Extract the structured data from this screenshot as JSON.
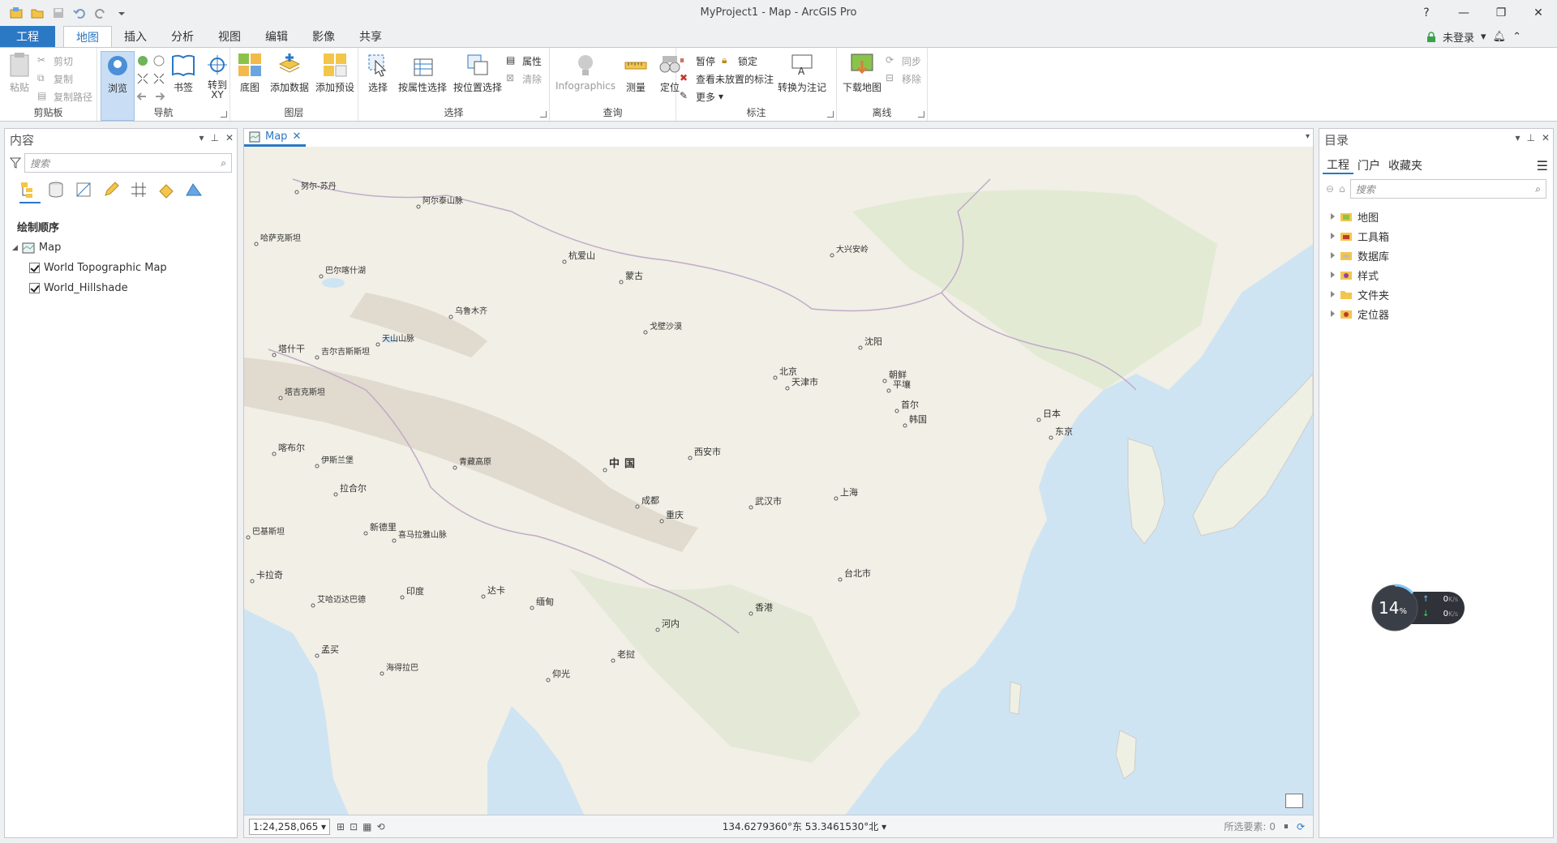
{
  "window": {
    "title": "MyProject1 - Map - ArcGIS Pro",
    "help": "?"
  },
  "ribbon_tabs": [
    "工程",
    "地图",
    "插入",
    "分析",
    "视图",
    "编辑",
    "影像",
    "共享"
  ],
  "account": {
    "label": "未登录"
  },
  "ribbon": {
    "clipboard": {
      "label": "剪贴板",
      "paste": "粘贴",
      "cut": "剪切",
      "copy": "复制",
      "copy_path": "复制路径"
    },
    "navigate": {
      "label": "导航",
      "explore": "浏览",
      "bookmarks": "书签",
      "goto_xy": "转到\nXY"
    },
    "layer": {
      "label": "图层",
      "basemap": "底图",
      "add_data": "添加数据",
      "add_preset": "添加预设"
    },
    "selection": {
      "label": "选择",
      "select": "选择",
      "by_attr": "按属性选择",
      "by_loc": "按位置选择",
      "attributes": "属性",
      "clear": "清除"
    },
    "inquiry": {
      "label": "查询",
      "infographics": "Infographics",
      "measure": "测量",
      "locate": "定位"
    },
    "labeling": {
      "label": "标注",
      "pause": "暂停",
      "lock": "锁定",
      "view_unplaced": "查看未放置的标注",
      "more": "更多",
      "convert": "转换为注记"
    },
    "offline": {
      "label": "离线",
      "download": "下载地图",
      "sync": "同步",
      "remove": "移除"
    }
  },
  "contents": {
    "title": "内容",
    "search_placeholder": "搜索",
    "section": "绘制顺序",
    "map_name": "Map",
    "layers": [
      "World Topographic Map",
      "World_Hillshade"
    ]
  },
  "map_tab": {
    "label": "Map"
  },
  "map_labels": [
    "努尔-苏丹",
    "阿尔泰山脉",
    "哈萨克斯坦",
    "巴尔喀什湖",
    "杭爱山",
    "蒙古",
    "乌鲁木齐",
    "戈壁沙漠",
    "天山山脉",
    "塔什干",
    "吉尔吉斯斯坦",
    "塔吉克斯坦",
    "喀布尔",
    "伊斯兰堡",
    "拉合尔",
    "青藏高原",
    "中国",
    "西安市",
    "北京",
    "天津市",
    "沈阳",
    "朝鲜",
    "平壤",
    "首尔",
    "韩国",
    "日本",
    "东京",
    "大兴安岭",
    "成都",
    "重庆",
    "武汉市",
    "上海",
    "巴基斯坦",
    "新德里",
    "喜马拉雅山脉",
    "卡拉奇",
    "印度",
    "艾哈迈达巴德",
    "达卡",
    "缅甸",
    "河内",
    "台北市",
    "香港",
    "老挝",
    "孟买",
    "海得拉巴",
    "仰光"
  ],
  "status": {
    "scale": "1:24,258,065",
    "coords": "134.6279360°东 53.3461530°北",
    "selected": "所选要素: 0"
  },
  "catalog": {
    "title": "目录",
    "tabs": [
      "工程",
      "门户",
      "收藏夹"
    ],
    "search_placeholder": "搜索",
    "items": [
      "地图",
      "工具箱",
      "数据库",
      "样式",
      "文件夹",
      "定位器"
    ]
  },
  "speed_widget": {
    "percent": "14",
    "unit": "%",
    "up": "0",
    "down": "0",
    "rate_unit": "K/s"
  }
}
